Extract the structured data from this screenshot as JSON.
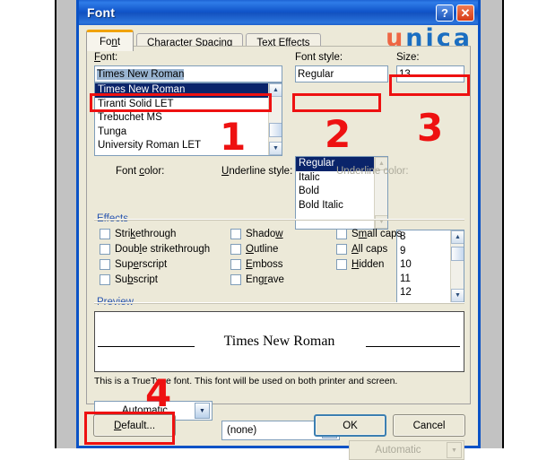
{
  "window": {
    "title": "Font",
    "help_button": "?",
    "close_button": "✕",
    "logo_first": "u",
    "logo_rest": "nica"
  },
  "tabs": [
    {
      "label": "Font",
      "active": true
    },
    {
      "label": "Character Spacing",
      "active": false
    },
    {
      "label": "Text Effects",
      "active": false
    }
  ],
  "font_section": {
    "font_label": "Font:",
    "font_value": "Times New Roman",
    "font_list": [
      "Times New Roman",
      "Tiranti Solid LET",
      "Trebuchet MS",
      "Tunga",
      "University Roman LET"
    ],
    "font_selected_index": 0,
    "style_label": "Font style:",
    "style_value": "Regular",
    "style_list": [
      "Regular",
      "Italic",
      "Bold",
      "Bold Italic"
    ],
    "style_selected_index": 0,
    "size_label": "Size:",
    "size_value": "13",
    "size_list": [
      "8",
      "9",
      "10",
      "11",
      "12"
    ]
  },
  "color_row": {
    "font_color_label": "Font color:",
    "font_color_value": "Automatic",
    "underline_style_label": "Underline style:",
    "underline_style_value": "(none)",
    "underline_color_label": "Underline color:",
    "underline_color_value": "Automatic",
    "underline_color_disabled": true
  },
  "effects": {
    "group_label": "Effects",
    "column1": [
      {
        "label": "Strikethrough",
        "checked": false
      },
      {
        "label": "Double strikethrough",
        "checked": false
      },
      {
        "label": "Superscript",
        "checked": false
      },
      {
        "label": "Subscript",
        "checked": false
      }
    ],
    "column2": [
      {
        "label": "Shadow",
        "checked": false
      },
      {
        "label": "Outline",
        "checked": false
      },
      {
        "label": "Emboss",
        "checked": false
      },
      {
        "label": "Engrave",
        "checked": false
      }
    ],
    "column3": [
      {
        "label": "Small caps",
        "checked": false
      },
      {
        "label": "All caps",
        "checked": false
      },
      {
        "label": "Hidden",
        "checked": false
      }
    ]
  },
  "preview": {
    "group_label": "Preview",
    "sample_text": "Times New Roman",
    "note": "This is a TrueType font. This font will be used on both printer and screen."
  },
  "buttons": {
    "default": "Default...",
    "ok": "OK",
    "cancel": "Cancel"
  },
  "annotations": {
    "n1": "1",
    "n2": "2",
    "n3": "3",
    "n4": "4",
    "color": "#ee1111"
  },
  "colors": {
    "titlebar_blue": "#0f53c8",
    "dialog_face": "#ece9d8",
    "tab_accent_orange": "#f0a30a",
    "logo_blue": "#1b6ec1",
    "logo_orange": "#ee6644",
    "selection_blue": "#0a246a"
  }
}
